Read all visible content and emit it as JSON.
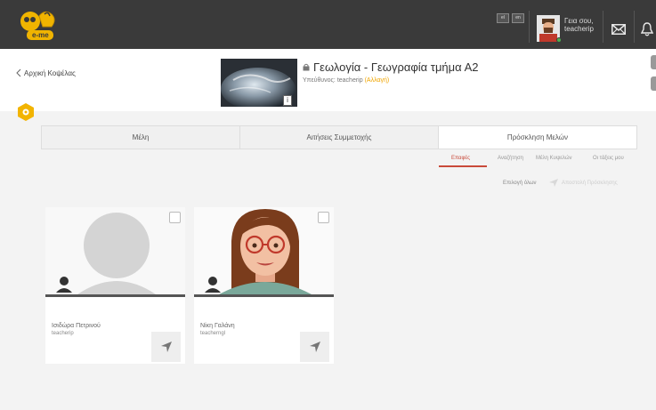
{
  "topbar": {
    "logo_text": "e-me",
    "lang_buttons": [
      "el",
      "en"
    ],
    "greeting": "Γεια σου,",
    "username": "teacherip"
  },
  "header": {
    "back_label": "Αρχική Κοψέλας",
    "title": "Γεωλογία - Γεωγραφία τμήμα Α2",
    "owner_prefix": "Υπεύθυνος: teacherip",
    "owner_change": "(Αλλαγή)",
    "info_label": "i"
  },
  "tabs": [
    {
      "label": "Μέλη",
      "active": false
    },
    {
      "label": "Αιτήσεις Συμμετοχής",
      "active": false
    },
    {
      "label": "Πρόσκληση Μελών",
      "active": true
    }
  ],
  "subtabs": [
    {
      "label": "Επαφές",
      "active": true
    },
    {
      "label": "Αναζήτηση",
      "active": false
    },
    {
      "label": "Μέλη Κυψελών",
      "active": false
    },
    {
      "label": "Οι τάξεις μου",
      "active": false
    }
  ],
  "actions": {
    "select_all": "Επιλογή όλων",
    "send_invite": "Αποστολή Πρόσκλησης"
  },
  "members": [
    {
      "name": "Ισιδώρα Πετρινού",
      "username": "teacherip",
      "avatar": "default-avatar"
    },
    {
      "name": "Νίκη Γαλάνη",
      "username": "teacherngl",
      "avatar": "cartoon-woman-avatar"
    }
  ],
  "colors": {
    "topbar": "#3a3a3a",
    "accent": "#f0a500",
    "active_subtab": "#c94a3a"
  }
}
